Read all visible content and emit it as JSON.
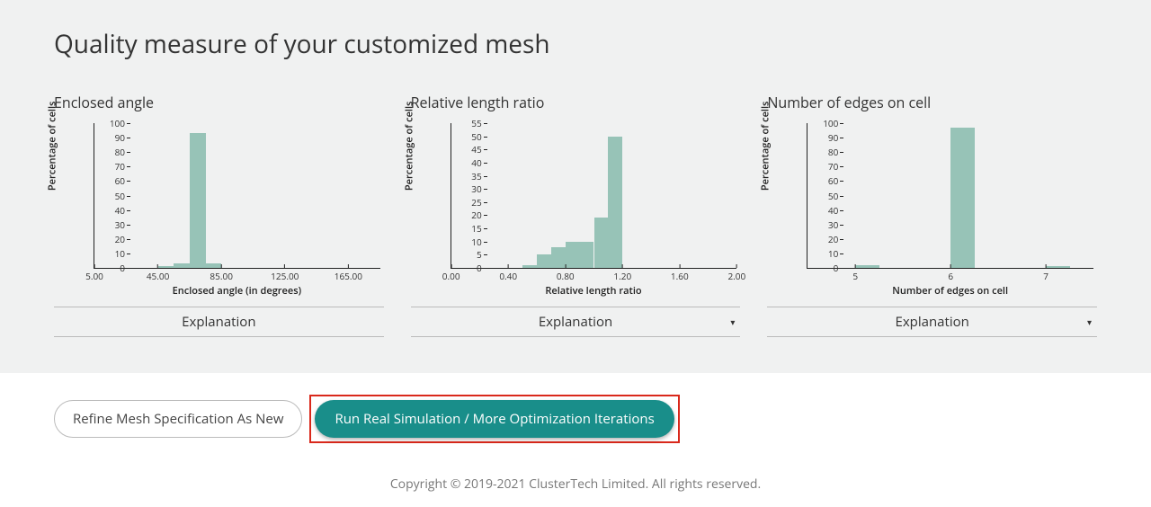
{
  "panel_title": "Quality measure of your customized mesh",
  "explain_label": "Explanation",
  "buttons": {
    "refine": "Refine Mesh Specification As New",
    "run": "Run Real Simulation / More Optimization Iterations"
  },
  "footer": "Copyright © 2019-2021 ClusterTech Limited. All rights reserved.",
  "chart_data": [
    {
      "type": "bar",
      "title": "Enclosed angle",
      "ylabel": "Percentage of cells",
      "xlabel": "Enclosed angle (in degrees)",
      "ylim": [
        0,
        100
      ],
      "yticks": [
        0,
        10,
        20,
        30,
        40,
        50,
        60,
        70,
        80,
        90,
        100
      ],
      "x_ticks": [
        5.0,
        45.0,
        85.0,
        125.0,
        165.0
      ],
      "x_tick_format": "fixed2",
      "x_range": [
        5,
        185
      ],
      "bin_width": 10,
      "categories": [
        45,
        55,
        65,
        75
      ],
      "values": [
        1,
        3,
        93,
        3
      ]
    },
    {
      "type": "bar",
      "title": "Relative length ratio",
      "ylabel": "Percentage of cells",
      "xlabel": "Relative length ratio",
      "ylim": [
        0,
        55
      ],
      "yticks": [
        0,
        5,
        10,
        15,
        20,
        25,
        30,
        35,
        40,
        45,
        50,
        55
      ],
      "x_ticks": [
        0.0,
        0.4,
        0.8,
        1.2,
        1.6,
        2.0
      ],
      "x_tick_format": "fixed2",
      "x_range": [
        0,
        2.0
      ],
      "bin_width": 0.1,
      "categories": [
        0.5,
        0.6,
        0.7,
        0.8,
        0.9,
        1.0,
        1.1
      ],
      "values": [
        1,
        5,
        8,
        10,
        10,
        19,
        50
      ]
    },
    {
      "type": "bar",
      "title": "Number of edges on cell",
      "ylabel": "Percentage of cells",
      "xlabel": "Number of edges on cell",
      "ylim": [
        0,
        100
      ],
      "yticks": [
        0,
        10,
        20,
        30,
        40,
        50,
        60,
        70,
        80,
        90,
        100
      ],
      "x_ticks": [
        5,
        6,
        7
      ],
      "x_tick_format": "int",
      "x_range": [
        4.5,
        7.5
      ],
      "bin_width": 0.25,
      "categories": [
        5,
        6,
        7
      ],
      "values": [
        2,
        97,
        1
      ]
    }
  ]
}
